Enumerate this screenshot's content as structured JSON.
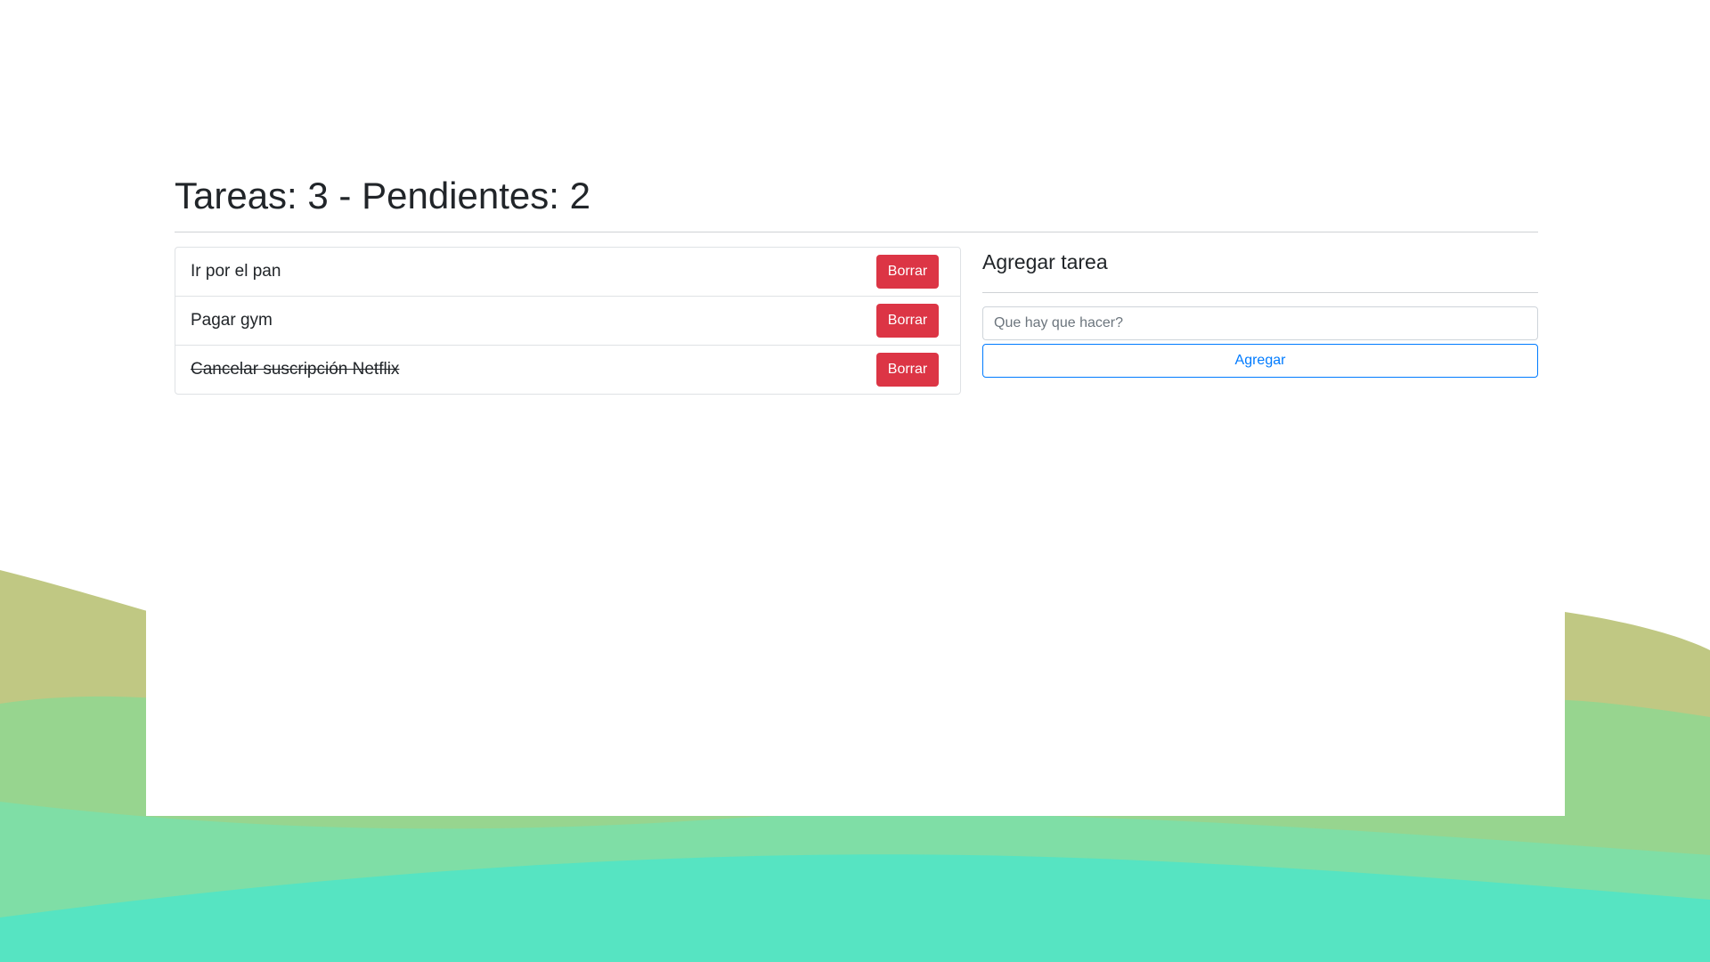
{
  "header": {
    "title": "Tareas: 3 - Pendientes: 2"
  },
  "tasks": [
    {
      "text": "Ir por el pan",
      "done": false,
      "delete_label": "Borrar"
    },
    {
      "text": "Pagar gym",
      "done": false,
      "delete_label": "Borrar"
    },
    {
      "text": "Cancelar suscripción Netflix",
      "done": true,
      "delete_label": "Borrar"
    }
  ],
  "form": {
    "title": "Agregar tarea",
    "input_placeholder": "Que hay que hacer?",
    "input_value": "",
    "submit_label": "Agregar"
  },
  "colors": {
    "danger": "#dc3545",
    "primary": "#007bff",
    "wave_back": "#c0c883",
    "wave_mid": "#97d58f",
    "wave_light": "#7fdea6",
    "wave_front": "#56e4c2"
  }
}
